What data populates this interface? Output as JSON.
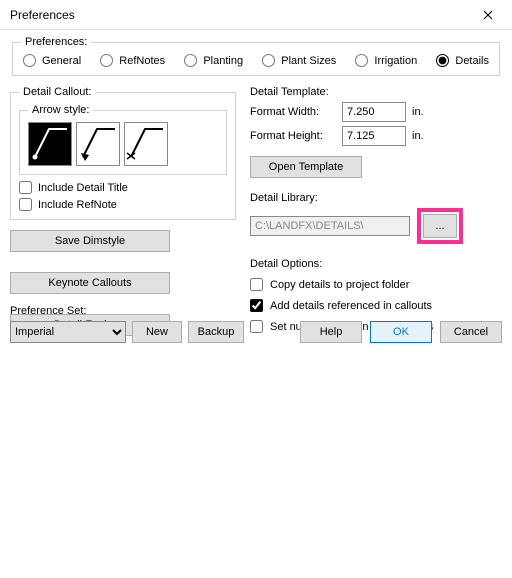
{
  "window": {
    "title": "Preferences"
  },
  "prefs_group_label": "Preferences:",
  "radios": {
    "general": "General",
    "refnotes": "RefNotes",
    "planting": "Planting",
    "plant_sizes": "Plant Sizes",
    "irrigation": "Irrigation",
    "details": "Details"
  },
  "callout": {
    "group_label": "Detail Callout:",
    "arrow_group_label": "Arrow style:",
    "include_title": "Include Detail Title",
    "include_refnote": "Include RefNote"
  },
  "left_buttons": {
    "save_dimstyle": "Save Dimstyle",
    "keynote_callouts": "Keynote Callouts",
    "detail_explorer": "Detail Explorer"
  },
  "template": {
    "label": "Detail Template:",
    "width_label": "Format Width:",
    "width_value": "7.250",
    "height_label": "Format Height:",
    "height_value": "7.125",
    "unit": "in.",
    "open_btn": "Open Template"
  },
  "library": {
    "label": "Detail Library:",
    "path": "C:\\LANDFX\\DETAILS\\",
    "browse": "..."
  },
  "options": {
    "label": "Detail Options:",
    "copy": "Copy details to project folder",
    "add_ref": "Add details referenced in callouts",
    "numeric": "Set numeric division for all details"
  },
  "prefset": {
    "label": "Preference Set:",
    "value": "Imperial",
    "new_btn": "New",
    "backup_btn": "Backup"
  },
  "dlg": {
    "help": "Help",
    "ok": "OK",
    "cancel": "Cancel"
  }
}
